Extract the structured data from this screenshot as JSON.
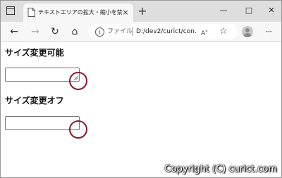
{
  "browser": {
    "tab": {
      "title": "テキストエリアの拡大・縮小を禁止",
      "close_glyph": "×"
    },
    "new_tab_glyph": "+",
    "window_controls": {
      "minimize": "—",
      "maximize": "□",
      "close": "✕"
    },
    "nav": {
      "back": "←",
      "forward": "→",
      "reload": "↻",
      "home": "⌂"
    },
    "address": {
      "info_glyph": "i",
      "scheme_label": "ファイル",
      "url": "D:/dev2/curict/con...",
      "read_aloud_glyph": "A",
      "favorites_glyph": "☆"
    },
    "more_glyph": "···"
  },
  "page": {
    "sections": [
      {
        "heading": "サイズ変更可能",
        "textarea_value": "",
        "resizable": true
      },
      {
        "heading": "サイズ変更オフ",
        "textarea_value": "",
        "resizable": false
      }
    ]
  },
  "annotations": {
    "marker_color": "#8b1a2b"
  },
  "watermark": "Copyright (C) curict.com"
}
